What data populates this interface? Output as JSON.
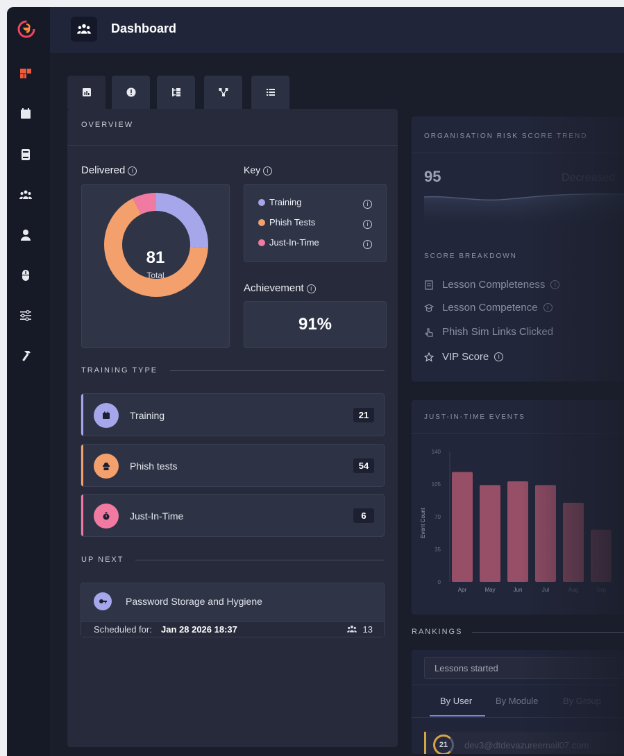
{
  "header": {
    "title": "Dashboard"
  },
  "sidebar": {
    "items": [
      "dashboard-icon",
      "calendar-icon",
      "book-icon",
      "users-icon",
      "user-icon",
      "mouse-icon",
      "sliders-icon",
      "hammer-icon"
    ]
  },
  "tabs": [
    "chart-icon",
    "alert-icon",
    "hierarchy-icon",
    "network-icon",
    "list-icon"
  ],
  "overview": {
    "title": "OVERVIEW",
    "delivered_label": "Delivered",
    "total_value": "81",
    "total_label": "Total",
    "key_label": "Key",
    "key_items": [
      {
        "label": "Training",
        "color": "#a5a7ea"
      },
      {
        "label": "Phish Tests",
        "color": "#f4a06c"
      },
      {
        "label": "Just-In-Time",
        "color": "#f07aa2"
      }
    ],
    "achievement_label": "Achievement",
    "achievement_value": "91%",
    "training_type_title": "TRAINING TYPE",
    "training_types": [
      {
        "label": "Training",
        "count": "21",
        "color": "#a5a7ea"
      },
      {
        "label": "Phish tests",
        "count": "54",
        "color": "#f4a06c"
      },
      {
        "label": "Just-In-Time",
        "count": "6",
        "color": "#f07aa2"
      }
    ],
    "up_next_title": "UP NEXT",
    "up_next": {
      "title": "Password Storage and Hygiene",
      "scheduled_prefix": "Scheduled for:",
      "scheduled_date": "Jan 28 2026 18:37",
      "attendees": "13"
    }
  },
  "risk": {
    "title": "ORGANISATION RISK SCORE TREND",
    "score": "95",
    "trend_label": "Decreased",
    "breakdown_title": "SCORE BREAKDOWN",
    "breakdown": [
      {
        "label": "Lesson Completeness",
        "icon": "document-icon"
      },
      {
        "label": "Lesson Competence",
        "icon": "graduation-icon"
      },
      {
        "label": "Phish Sim Links Clicked",
        "icon": "pointer-icon"
      },
      {
        "label": "VIP Score",
        "icon": "star-icon"
      }
    ]
  },
  "jit": {
    "title": "JUST-IN-TIME EVENTS",
    "chart_data": {
      "type": "bar",
      "categories": [
        "Apr",
        "May",
        "Jun",
        "Jul",
        "Aug",
        "Sep"
      ],
      "values": [
        118,
        104,
        108,
        104,
        85,
        56
      ],
      "ylabel": "Event Count",
      "yticks": [
        "140",
        "105",
        "70",
        "35",
        "0"
      ],
      "ylim": [
        0,
        140
      ]
    }
  },
  "rankings": {
    "title": "RANKINGS",
    "select_value": "Lessons started",
    "tabs": [
      "By User",
      "By Module",
      "By Group"
    ],
    "first_row": {
      "count": "21",
      "user": "dev3@dtdevazureemail07.com"
    }
  }
}
